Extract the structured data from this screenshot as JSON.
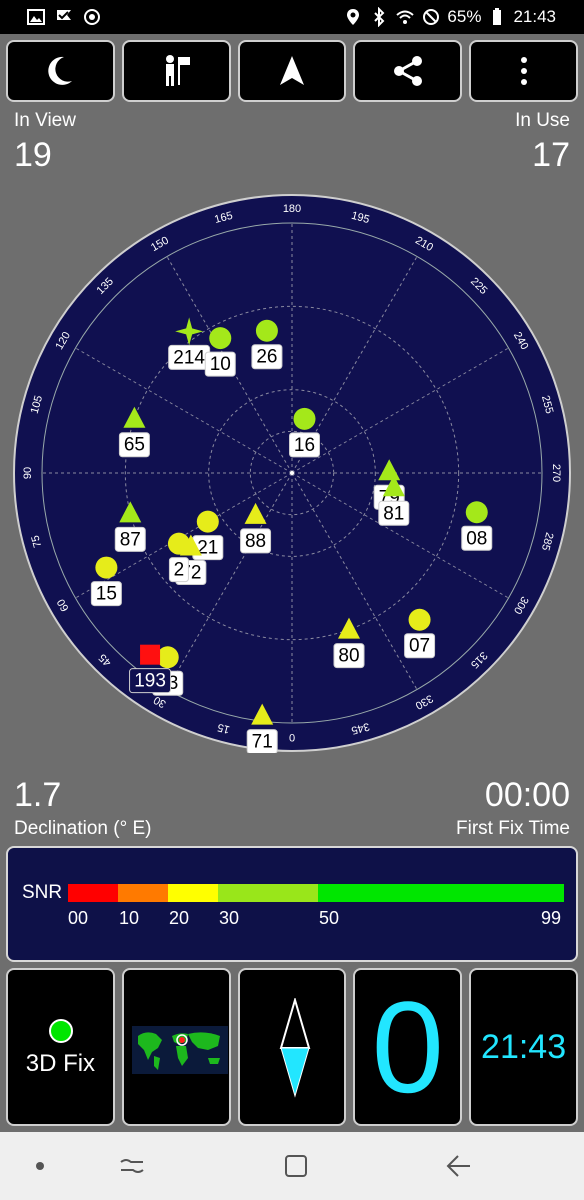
{
  "status_bar": {
    "icons_left": [
      "gallery-icon",
      "done-flag-icon",
      "sync-icon"
    ],
    "icons_right": [
      "location-icon",
      "bluetooth-icon",
      "wifi-icon",
      "dnd-icon",
      "battery-icon"
    ],
    "battery": "65%",
    "time": "21:43"
  },
  "toolbar": {
    "buttons": [
      {
        "name": "night-mode",
        "icon": "moon-icon"
      },
      {
        "name": "person-flag",
        "icon": "person-flag-icon"
      },
      {
        "name": "navigate",
        "icon": "navigation-arrow-icon"
      },
      {
        "name": "share",
        "icon": "share-icon"
      },
      {
        "name": "more",
        "icon": "more-vertical-icon"
      }
    ]
  },
  "stats": {
    "in_view_label": "In View",
    "in_view": "19",
    "in_use_label": "In Use",
    "in_use": "17",
    "declination_value": "1.7",
    "declination_label": "Declination (° E)",
    "first_fix_value": "00:00",
    "first_fix_label": "First Fix Time"
  },
  "sky": {
    "background": "#101050",
    "ring_labels": [
      "180",
      "195",
      "210",
      "225",
      "240",
      "255",
      "270",
      "285",
      "300",
      "315",
      "330",
      "345",
      "0",
      "15",
      "30",
      "45",
      "60",
      "75",
      "90",
      "105",
      "120",
      "135",
      "150",
      "165"
    ],
    "satellites": [
      {
        "id": "214",
        "shape": "star",
        "color": "#a4e81a",
        "azimuth": 144,
        "elevation": 27
      },
      {
        "id": "10",
        "shape": "circle",
        "color": "#a4e81a",
        "azimuth": 152,
        "elevation": 35
      },
      {
        "id": "26",
        "shape": "circle",
        "color": "#a4e81a",
        "azimuth": 170,
        "elevation": 38
      },
      {
        "id": "16",
        "shape": "circle",
        "color": "#a4e81a",
        "azimuth": 193,
        "elevation": 70
      },
      {
        "id": "65",
        "shape": "triangle",
        "color": "#a4e81a",
        "azimuth": 109,
        "elevation": 30
      },
      {
        "id": "79",
        "shape": "triangle",
        "color": "#a4e81a",
        "azimuth": 269,
        "elevation": 55
      },
      {
        "id": "81",
        "shape": "triangle",
        "color": "#a4e81a",
        "azimuth": 278,
        "elevation": 53
      },
      {
        "id": "08",
        "shape": "circle",
        "color": "#a4e81a",
        "azimuth": 282,
        "elevation": 22
      },
      {
        "id": "21",
        "shape": "circle",
        "color": "#e6ec1a",
        "azimuth": 60,
        "elevation": 55
      },
      {
        "id": "88",
        "shape": "triangle",
        "color": "#e6ec1a",
        "azimuth": 41,
        "elevation": 70
      },
      {
        "id": "87",
        "shape": "triangle",
        "color": "#a4e81a",
        "azimuth": 76,
        "elevation": 30
      },
      {
        "id": "72",
        "shape": "triangle",
        "color": "#e6ec1a",
        "azimuth": 54,
        "elevation": 45
      },
      {
        "id": "2",
        "shape": "circle",
        "color": "#e6ec1a",
        "azimuth": 58,
        "elevation": 42
      },
      {
        "id": "15",
        "shape": "circle",
        "color": "#e6ec1a",
        "azimuth": 63,
        "elevation": 15
      },
      {
        "id": "07",
        "shape": "circle",
        "color": "#e6ec1a",
        "azimuth": 319,
        "elevation": 20
      },
      {
        "id": "80",
        "shape": "triangle",
        "color": "#e6ec1a",
        "azimuth": 340,
        "elevation": 30
      },
      {
        "id": "13",
        "shape": "circle",
        "color": "#e6ec1a",
        "azimuth": 34,
        "elevation": 10
      },
      {
        "id": "193",
        "shape": "square",
        "color": "#ff1010",
        "azimuth": 38,
        "elevation": 7
      },
      {
        "id": "71",
        "shape": "triangle",
        "color": "#e6ec1a",
        "azimuth": 7,
        "elevation": 2
      }
    ]
  },
  "snr": {
    "label": "SNR",
    "ticks": [
      "00",
      "10",
      "20",
      "30",
      "50",
      "99"
    ],
    "colors": [
      "#ff0000",
      "#ff7a00",
      "#ffff00",
      "#99e61a",
      "#00e600"
    ]
  },
  "tiles": {
    "fix_label": "3D Fix",
    "fix_dot_color": "#00e600",
    "big_digit": "0",
    "clock": "21:43",
    "accent": "#22e6ff"
  },
  "navbar": {
    "buttons": [
      {
        "name": "nav-dot",
        "icon": "dot-icon"
      },
      {
        "name": "recent-apps",
        "icon": "recent-apps-icon"
      },
      {
        "name": "home",
        "icon": "home-square-icon"
      },
      {
        "name": "back",
        "icon": "back-arrow-icon"
      }
    ]
  }
}
